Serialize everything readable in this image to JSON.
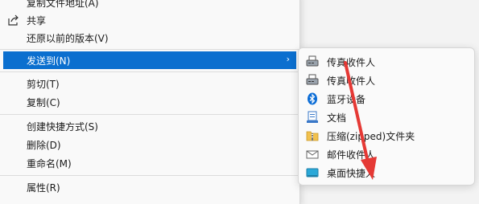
{
  "context_menu": {
    "items": [
      {
        "label": "复制文件地址(A)"
      },
      {
        "label": "共享"
      },
      {
        "label": "还原以前的版本(V)"
      },
      {
        "label": "发送到(N)"
      },
      {
        "label": "剪切(T)"
      },
      {
        "label": "复制(C)"
      },
      {
        "label": "创建快捷方式(S)"
      },
      {
        "label": "删除(D)"
      },
      {
        "label": "重命名(M)"
      },
      {
        "label": "属性(R)"
      }
    ],
    "highlight_color": "#0b6fcf"
  },
  "send_to_submenu": {
    "items": [
      {
        "label": "传真收件人",
        "icon": "fax-icon"
      },
      {
        "label": "传真收件人",
        "icon": "fax-icon"
      },
      {
        "label": "蓝牙设备",
        "icon": "bluetooth-icon"
      },
      {
        "label": "文档",
        "icon": "document-icon"
      },
      {
        "label": "压缩(zipped)文件夹",
        "icon": "zip-folder-icon"
      },
      {
        "label": "邮件收件人",
        "icon": "mail-icon"
      },
      {
        "label": "桌面快捷人",
        "icon": "desktop-icon"
      }
    ]
  },
  "annotation": {
    "arrow_color": "#e53935"
  }
}
